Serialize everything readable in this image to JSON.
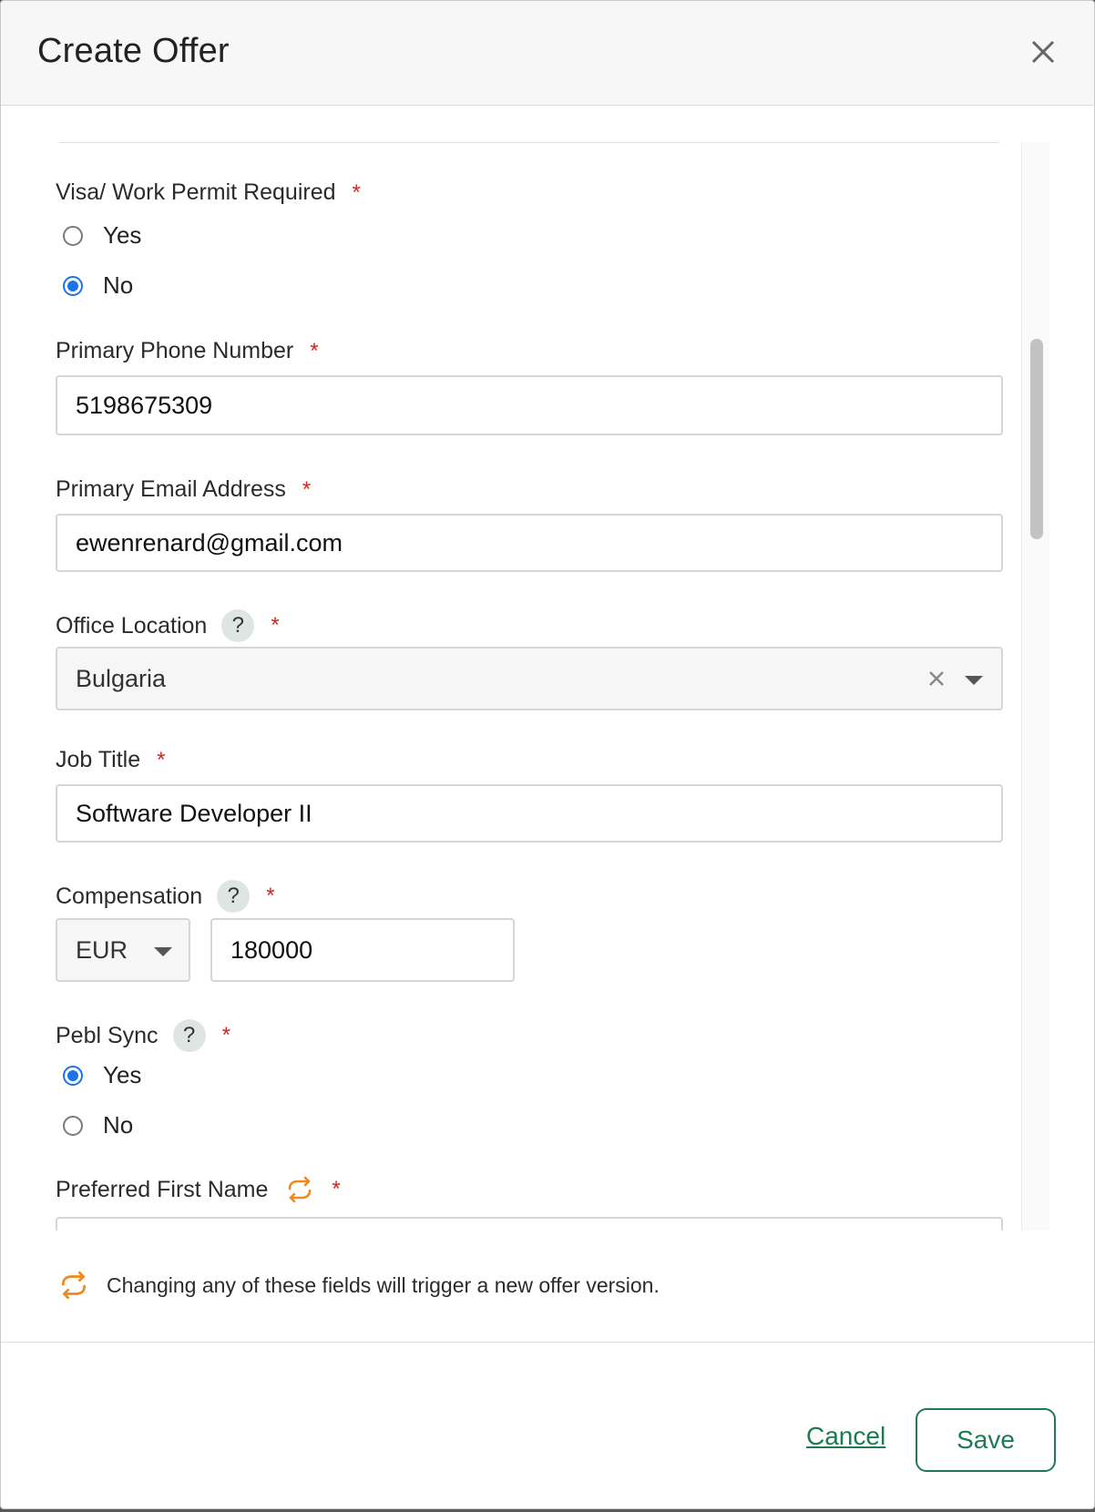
{
  "modal": {
    "title": "Create Offer",
    "close_icon": "close-icon"
  },
  "form": {
    "visa": {
      "label": "Visa/ Work Permit Required",
      "required_mark": "*",
      "options": [
        {
          "label": "Yes",
          "checked": false
        },
        {
          "label": "No",
          "checked": true
        }
      ]
    },
    "phone": {
      "label": "Primary Phone Number",
      "required_mark": "*",
      "value": "5198675309"
    },
    "email": {
      "label": "Primary Email Address",
      "required_mark": "*",
      "value": "ewenrenard@gmail.com"
    },
    "office": {
      "label": "Office Location",
      "help_icon": "question-icon",
      "help_glyph": "?",
      "required_mark": "*",
      "value": "Bulgaria"
    },
    "job_title": {
      "label": "Job Title",
      "required_mark": "*",
      "value": "Software Developer II"
    },
    "compensation": {
      "label": "Compensation",
      "help_glyph": "?",
      "required_mark": "*",
      "currency": "EUR",
      "amount": "180000"
    },
    "pebl_sync": {
      "label": "Pebl Sync",
      "help_glyph": "?",
      "required_mark": "*",
      "options": [
        {
          "label": "Yes",
          "checked": true
        },
        {
          "label": "No",
          "checked": false
        }
      ]
    },
    "preferred_first_name": {
      "label": "Preferred First Name",
      "sync_icon": "sync-icon",
      "required_mark": "*"
    }
  },
  "notice": {
    "icon": "sync-icon",
    "text": "Changing any of these fields will trigger a new offer version."
  },
  "footer": {
    "cancel_label": "Cancel",
    "save_label": "Save"
  },
  "colors": {
    "accent_green": "#1e7a52",
    "radio_blue": "#1a73e8",
    "required_red": "#d0271d",
    "sync_orange": "#f08a1c"
  }
}
